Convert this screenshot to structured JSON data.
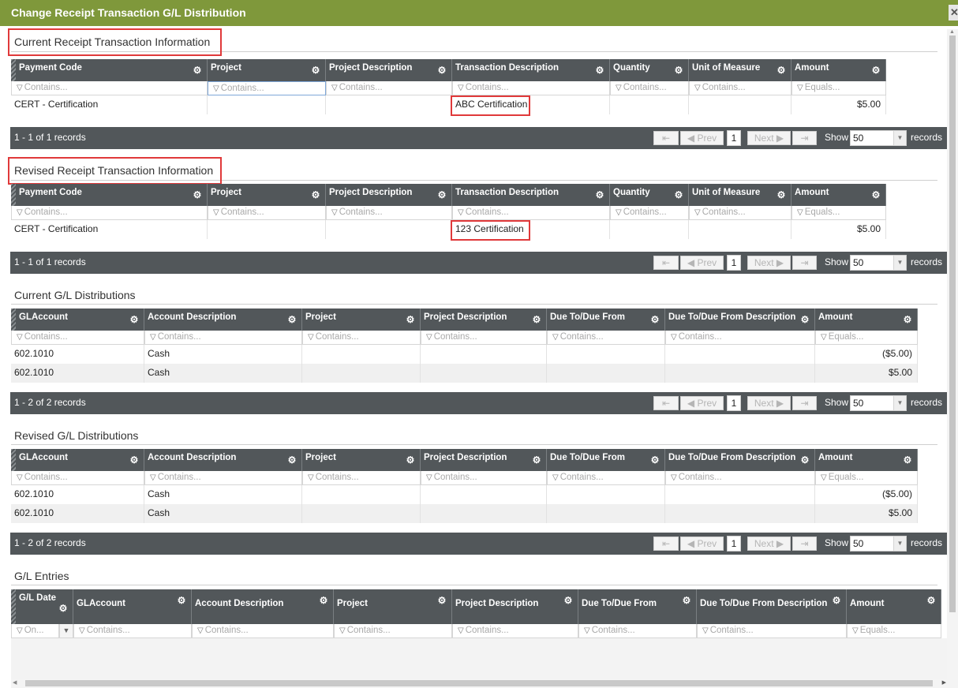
{
  "window": {
    "title": "Change Receipt Transaction G/L Distribution",
    "close_glyph": "✕"
  },
  "icons": {
    "gear": "gear-icon",
    "filter": "filter-funnel-icon",
    "dropdown": "chevron-down-icon"
  },
  "colors": {
    "titlebar": "#7f983b",
    "grid_header": "#52575a",
    "highlight": "#e0393a"
  },
  "receipt_columns": [
    "Payment Code",
    "Project",
    "Project Description",
    "Transaction Description",
    "Quantity",
    "Unit of Measure",
    "Amount"
  ],
  "receipt_filters": [
    "Contains...",
    "Contains...",
    "Contains...",
    "Contains...",
    "Contains...",
    "Contains...",
    "Equals..."
  ],
  "gl_columns": [
    "GLAccount",
    "Account Description",
    "Project",
    "Project Description",
    "Due To/Due From",
    "Due To/Due From Description",
    "Amount"
  ],
  "gl_filters": [
    "Contains...",
    "Contains...",
    "Contains...",
    "Contains...",
    "Contains...",
    "Contains...",
    "Equals..."
  ],
  "pager_labels": {
    "first": "⇤",
    "prev": "◀ Prev",
    "page": "1",
    "next": "Next ▶",
    "last": "⇥",
    "show": "Show",
    "page_size": "50",
    "records": "records"
  },
  "current_receipt": {
    "title": "Current Receipt Transaction Information",
    "row": [
      "CERT - Certification",
      "",
      "",
      "ABC Certification",
      "",
      "",
      "$5.00"
    ],
    "pager_text": "1 - 1 of 1 records"
  },
  "revised_receipt": {
    "title": "Revised Receipt Transaction Information",
    "row": [
      "CERT - Certification",
      "",
      "",
      "123 Certification",
      "",
      "",
      "$5.00"
    ],
    "pager_text": "1 - 1 of 1 records"
  },
  "current_gl": {
    "title": "Current G/L Distributions",
    "rows": [
      [
        "602.1010",
        "Cash",
        "",
        "",
        "",
        "",
        "($5.00)"
      ],
      [
        "602.1010",
        "Cash",
        "",
        "",
        "",
        "",
        "$5.00"
      ]
    ],
    "pager_text": "1 - 2 of 2 records"
  },
  "revised_gl": {
    "title": "Revised G/L Distributions",
    "rows": [
      [
        "602.1010",
        "Cash",
        "",
        "",
        "",
        "",
        "($5.00)"
      ],
      [
        "602.1010",
        "Cash",
        "",
        "",
        "",
        "",
        "$5.00"
      ]
    ],
    "pager_text": "1 - 2 of 2 records"
  },
  "gl_entries": {
    "title": "G/L Entries",
    "columns": [
      "G/L Date",
      "GLAccount",
      "Account Description",
      "Project",
      "Project Description",
      "Due To/Due From",
      "Due To/Due From Description",
      "Amount"
    ],
    "filters": [
      "On...",
      "Contains...",
      "Contains...",
      "Contains...",
      "Contains...",
      "Contains...",
      "Contains...",
      "Equals..."
    ]
  }
}
